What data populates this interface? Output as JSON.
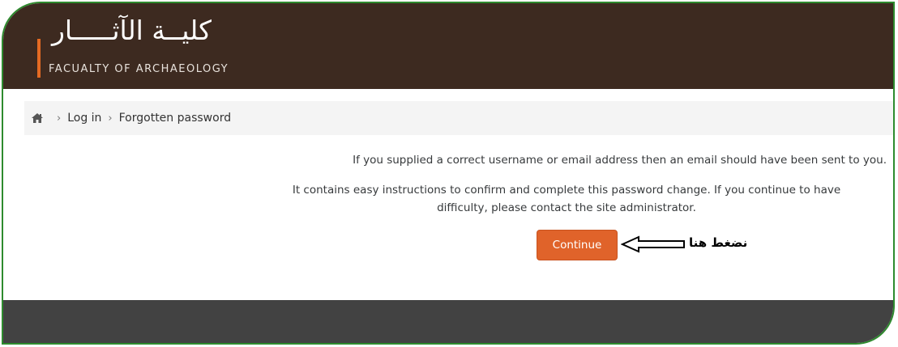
{
  "header": {
    "logo_arabic": "كليــة الآثـــــار",
    "logo_english": "FACUALTY OF ARCHAEOLOGY"
  },
  "breadcrumb": {
    "home_icon": "home-icon",
    "items": [
      "Log in",
      "Forgotten password"
    ]
  },
  "main": {
    "message_1": "If you supplied a correct username or email address then an email should have been sent to you.",
    "message_2_line1": "It contains easy instructions to confirm and complete this password change. If you continue to have",
    "message_2_line2": "difficulty, please contact the site administrator.",
    "continue_label": "Continue",
    "annotation": "نضغط هنا"
  },
  "colors": {
    "header_bg": "#3d2a20",
    "accent": "#e46a23",
    "button": "#e0632a",
    "footer_bg": "#424242",
    "frame": "#2e8b2e"
  }
}
